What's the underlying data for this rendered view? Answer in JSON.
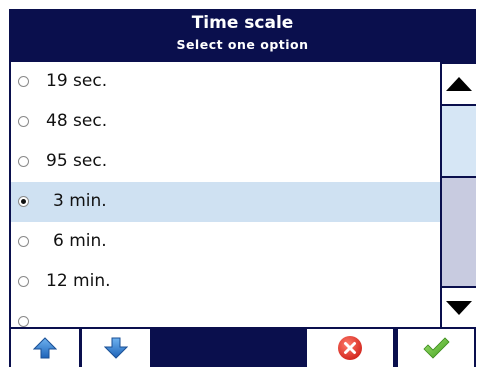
{
  "header": {
    "title": "Time scale",
    "subtitle": "Select one option"
  },
  "options": [
    {
      "label": "19 sec.",
      "selected": false
    },
    {
      "label": "48 sec.",
      "selected": false
    },
    {
      "label": "95 sec.",
      "selected": false
    },
    {
      "label": "3 min.",
      "selected": true
    },
    {
      "label": "6 min.",
      "selected": false
    },
    {
      "label": "12 min.",
      "selected": false
    }
  ],
  "colors": {
    "frame": "#0a0f4d",
    "selected_row": "#cfe1f2",
    "arrow_blue": "#2f7fd0",
    "cancel_red": "#e8342c",
    "confirm_green": "#5cbf2a"
  },
  "icons": {
    "scroll_up": "triangle-up-icon",
    "scroll_down": "triangle-down-icon",
    "move_up": "arrow-up-icon",
    "move_down": "arrow-down-icon",
    "cancel": "close-circle-icon",
    "confirm": "checkmark-icon"
  }
}
